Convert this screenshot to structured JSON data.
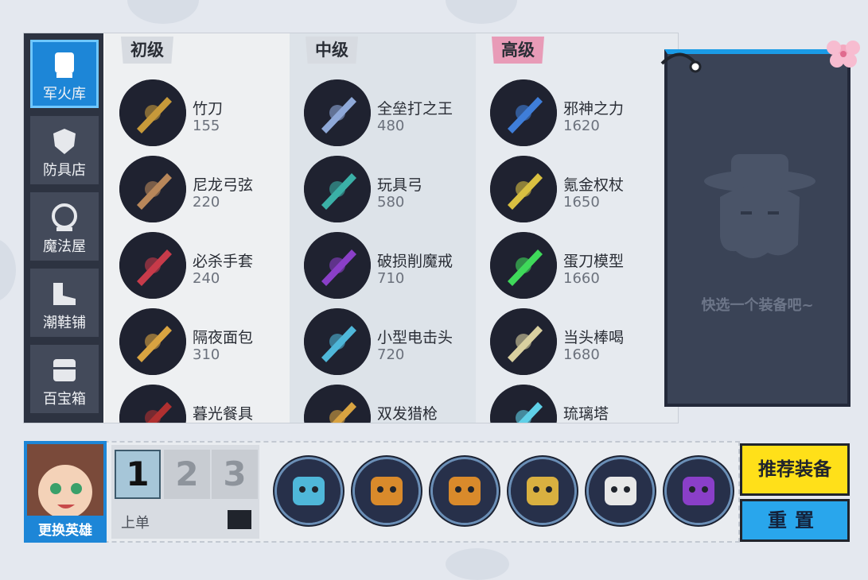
{
  "nav": [
    {
      "label": "军火库",
      "icon": "fist-icon",
      "active": true
    },
    {
      "label": "防具店",
      "icon": "shield-icon",
      "active": false
    },
    {
      "label": "魔法屋",
      "icon": "crystal-ball-icon",
      "active": false
    },
    {
      "label": "潮鞋铺",
      "icon": "boot-icon",
      "active": false
    },
    {
      "label": "百宝箱",
      "icon": "chest-icon",
      "active": false
    }
  ],
  "tiers": [
    {
      "title": "初级",
      "items": [
        {
          "name": "竹刀",
          "price": "155",
          "icon": "bamboo-sword-icon",
          "color": "#c79a3a"
        },
        {
          "name": "尼龙弓弦",
          "price": "220",
          "icon": "bowstring-icon",
          "color": "#b8875a"
        },
        {
          "name": "必杀手套",
          "price": "240",
          "icon": "boxing-glove-icon",
          "color": "#c73b4a"
        },
        {
          "name": "隔夜面包",
          "price": "310",
          "icon": "bread-icon",
          "color": "#d9a441"
        },
        {
          "name": "暮光餐具",
          "price": "",
          "icon": "cutlery-icon",
          "color": "#b03030"
        }
      ]
    },
    {
      "title": "中级",
      "items": [
        {
          "name": "全垒打之王",
          "price": "480",
          "icon": "bat-icon",
          "color": "#8fa9d8"
        },
        {
          "name": "玩具弓",
          "price": "580",
          "icon": "toy-bow-icon",
          "color": "#3bb0a7"
        },
        {
          "name": "破损削魔戒",
          "price": "710",
          "icon": "ring-icon",
          "color": "#8a3fc8"
        },
        {
          "name": "小型电击头",
          "price": "720",
          "icon": "shock-head-icon",
          "color": "#4fb7d9"
        },
        {
          "name": "双发猎枪",
          "price": "",
          "icon": "shotgun-icon",
          "color": "#d9a441"
        }
      ]
    },
    {
      "title": "高级",
      "items": [
        {
          "name": "邪神之力",
          "price": "1620",
          "icon": "spear-icon",
          "color": "#3f7ed9"
        },
        {
          "name": "氪金权杖",
          "price": "1650",
          "icon": "scepter-icon",
          "color": "#d9c041"
        },
        {
          "name": "蛋刀模型",
          "price": "1660",
          "icon": "scythe-icon",
          "color": "#3fd95a"
        },
        {
          "name": "当头棒喝",
          "price": "1680",
          "icon": "fan-icon",
          "color": "#d9d0a0"
        },
        {
          "name": "琉璃塔",
          "price": "",
          "icon": "crystal-tower-icon",
          "color": "#5fd0e8"
        }
      ]
    }
  ],
  "card": {
    "hint": "快选一个装备吧~"
  },
  "hero": {
    "button": "更换英雄"
  },
  "slots": {
    "tabs": [
      "1",
      "2",
      "3"
    ],
    "selected": "1",
    "label": "上单"
  },
  "build": [
    {
      "icon": "blade-icon",
      "color": "#4fb7d9"
    },
    {
      "icon": "hazmat-suit-icon",
      "color": "#d98a2b"
    },
    {
      "icon": "spiked-box-icon",
      "color": "#d98a2b"
    },
    {
      "icon": "helmet-icon",
      "color": "#d9b040"
    },
    {
      "icon": "medkit-icon",
      "color": "#e8e8e8"
    },
    {
      "icon": "purple-cat-icon",
      "color": "#8a3fc8"
    }
  ],
  "buttons": {
    "recommend": "推荐装备",
    "reset": "重置"
  }
}
